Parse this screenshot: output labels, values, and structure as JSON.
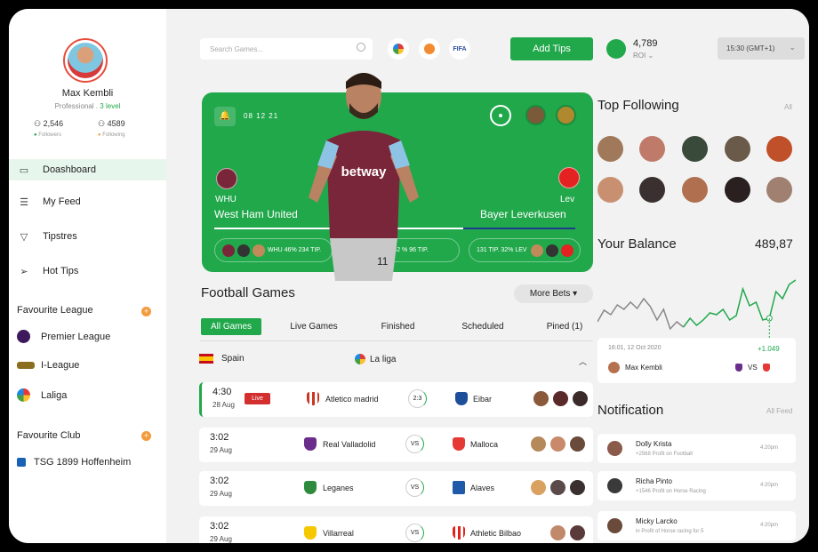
{
  "profile": {
    "name": "Max Kembli",
    "role": "Professional",
    "sep": ".",
    "level": "3 level",
    "followers_count": "2,546",
    "followers_label": "Followers",
    "following_count": "4589",
    "following_label": "Following"
  },
  "nav": [
    {
      "label": "Doashboard",
      "icon": "folder-icon"
    },
    {
      "label": "My Feed",
      "icon": "feed-icon"
    },
    {
      "label": "Tipstres",
      "icon": "filter-icon"
    },
    {
      "label": "Hot Tips",
      "icon": "send-icon"
    }
  ],
  "favourite_league": {
    "title": "Favourite League",
    "items": [
      "Premier League",
      "I-League",
      "Laliga"
    ]
  },
  "favourite_club": {
    "title": "Favourite Club",
    "items": [
      "TSG 1899 Hoffenheim"
    ]
  },
  "topbar": {
    "search_placeholder": "Search Games...",
    "fifa": "FIFA",
    "add_tips": "Add Tips",
    "wallet_amount": "4,789",
    "wallet_label": "ROI ⌄",
    "timezone": "15:30 (GMT+1)"
  },
  "hero": {
    "date": "08 12 21",
    "home_abbr": "WHU",
    "home_name": "West Ham United",
    "away_abbr": "Lev",
    "away_name": "Bayer Leverkusen",
    "home_stat": "WHU 46% 234 TIP.",
    "draw_stat": "DRAW 32 % 96 TIP.",
    "away_stat": "131 TIP. 32% LEV",
    "sponsor": "betway",
    "shirt_number": "11"
  },
  "games": {
    "title": "Football Games",
    "more_bets": "More Bets ▾",
    "tabs": [
      "All Games",
      "Live Games",
      "Finished",
      "Scheduled",
      "Pined (1)"
    ],
    "country": "Spain",
    "league": "La liga",
    "matches": [
      {
        "time": "4:30",
        "date": "28 Aug",
        "live": "Live",
        "home": "Atletico madrid",
        "score": "2:3",
        "away": "Eibar"
      },
      {
        "time": "3:02",
        "date": "29 Aug",
        "home": "Real Valladolid",
        "score": "VS",
        "away": "Malloca"
      },
      {
        "time": "3:02",
        "date": "29 Aug",
        "home": "Leganes",
        "score": "VS",
        "away": "Alaves"
      },
      {
        "time": "3:02",
        "date": "29 Aug",
        "home": "Villarreal",
        "score": "VS",
        "away": "Athletic Bilbao"
      }
    ]
  },
  "following": {
    "title": "Top Following",
    "all": "All"
  },
  "balance": {
    "title": "Your Balance",
    "amount": "489,87",
    "date": "16:01, 12 Oct 2020",
    "gain": "+1.049",
    "user": "Max Kembli",
    "vs": "VS",
    "chart_points": [
      62,
      49,
      54,
      43,
      48,
      40,
      47,
      36,
      45,
      60,
      48,
      70,
      62,
      68,
      58,
      66,
      60,
      52,
      54,
      48,
      60,
      55,
      25,
      44,
      40,
      60,
      58,
      28,
      36,
      20,
      15
    ]
  },
  "notifications": {
    "title": "Notification",
    "all": "All Feed",
    "items": [
      {
        "name": "Dolly Krista",
        "sub": "+2568 Profit on Football",
        "time": "4:20pm"
      },
      {
        "name": "Richa Pinto",
        "sub": "+1546 Profit on Horse Racing",
        "time": "4:20pm"
      },
      {
        "name": "Micky Larcko",
        "sub": "in Profit of Horse racing for 5",
        "time": "4:20pm"
      }
    ]
  },
  "colors": {
    "accent": "#21a84b",
    "live": "#d32f2f",
    "plus": "#f39c3d"
  }
}
